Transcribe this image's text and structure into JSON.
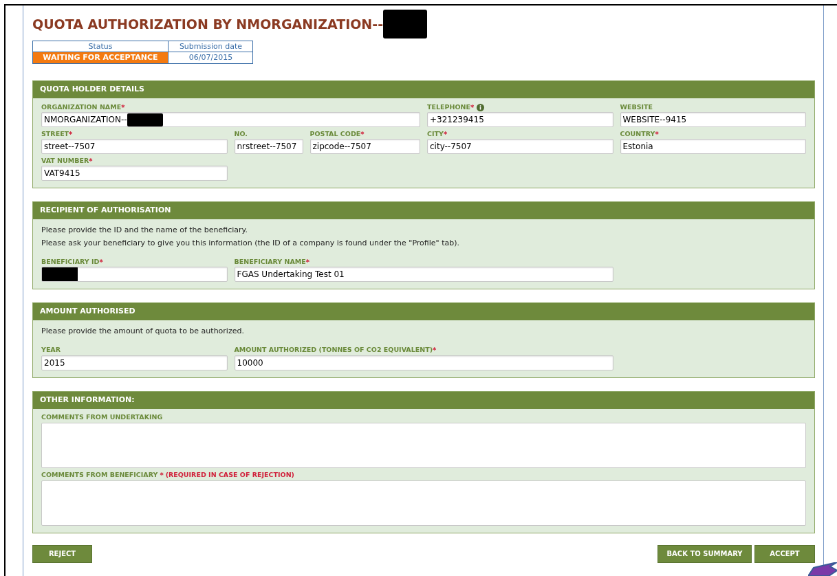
{
  "title": {
    "text": "QUOTA AUTHORIZATION BY NMORGANIZATION--",
    "redacted": true
  },
  "status_table": {
    "columns": [
      "Status",
      "Submission date"
    ],
    "status": "WAITING FOR ACCEPTANCE",
    "date": "06/07/2015"
  },
  "sections": [
    {
      "title": "QUOTA HOLDER DETAILS",
      "fields": [
        {
          "label": "ORGANIZATION NAME",
          "mark": "*",
          "info": false,
          "value": "NMORGANIZATION--",
          "redacted": true
        },
        {
          "label": "TELEPHONE",
          "mark": "*",
          "info": true,
          "value": "+321239415",
          "redacted": false
        },
        {
          "label": "WEBSITE",
          "info": false,
          "value": "WEBSITE--9415",
          "redacted": false
        },
        {
          "label": "STREET",
          "mark": "*",
          "info": false,
          "value": "street--7507",
          "redacted": false
        },
        {
          "label": "NO.",
          "info": false,
          "value": "nrstreet--7507",
          "redacted": false
        },
        {
          "label": "POSTAL CODE",
          "mark": "*",
          "info": false,
          "value": "zipcode--7507",
          "redacted": false
        },
        {
          "label": "CITY",
          "mark": "*",
          "info": false,
          "value": "city--7507",
          "redacted": false
        },
        {
          "label": "COUNTRY",
          "mark": "*",
          "info": false,
          "value": "Estonia",
          "redacted": false
        },
        {
          "label": "VAT NUMBER",
          "mark": "*",
          "info": false,
          "value": "VAT9415",
          "redacted": false
        }
      ]
    },
    {
      "title": "RECIPIENT OF AUTHORISATION",
      "intro": [
        "Please provide the ID and the name of the beneficiary.",
        "Please ask your beneficiary to give you this information (the ID of a company is found under the \"Profile\" tab)."
      ],
      "fields": [
        {
          "label": "BENEFICIARY ID",
          "mark": "*",
          "info": false,
          "redacted": true
        },
        {
          "label": "BENEFICIARY NAME",
          "mark": "*",
          "info": false,
          "value": "FGAS Undertaking Test 01",
          "redacted": false
        }
      ]
    },
    {
      "title": "AMOUNT AUTHORISED",
      "intro": [
        "Please provide the amount of quota to be authorized."
      ],
      "fields": [
        {
          "label": "YEAR",
          "info": false,
          "value": "2015",
          "redacted": false
        },
        {
          "label": "AMOUNT AUTHORIZED (TONNES OF CO2 EQUIVALENT)",
          "mark": "*",
          "info": false,
          "value": "10000",
          "redacted": false
        }
      ]
    },
    {
      "title": "OTHER INFORMATION:",
      "comments": [
        {
          "label": "COMMENTS FROM UNDERTAKING"
        },
        {
          "label": "COMMENTS FROM BENEFICIARY",
          "mark": "*",
          "note": "(REQUIRED IN CASE OF REJECTION)"
        }
      ]
    }
  ],
  "buttons_left": [
    "REJECT"
  ],
  "buttons_right": [
    "BACK TO SUMMARY",
    "ACCEPT"
  ]
}
